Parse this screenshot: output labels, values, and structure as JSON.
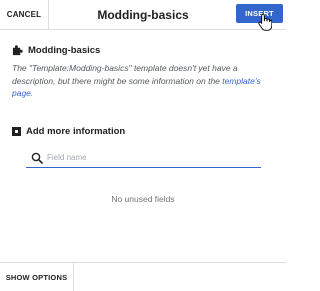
{
  "header": {
    "cancel_label": "CANCEL",
    "title": "Modding-basics",
    "insert_label": "INSERT"
  },
  "template": {
    "name": "Modding-basics",
    "description_prefix": "The \"Template:Modding-basics\" template doesn't yet have a description, but there might be some information on the ",
    "link_text": "template's page",
    "description_suffix": "."
  },
  "add_info": {
    "label": "Add more information",
    "search_placeholder": "Field name",
    "empty_message": "No unused fields"
  },
  "footer": {
    "show_options_label": "SHOW OPTIONS"
  },
  "colors": {
    "accent": "#3366cc",
    "border": "#dcdde1",
    "text": "#202122",
    "muted": "#72777d"
  }
}
